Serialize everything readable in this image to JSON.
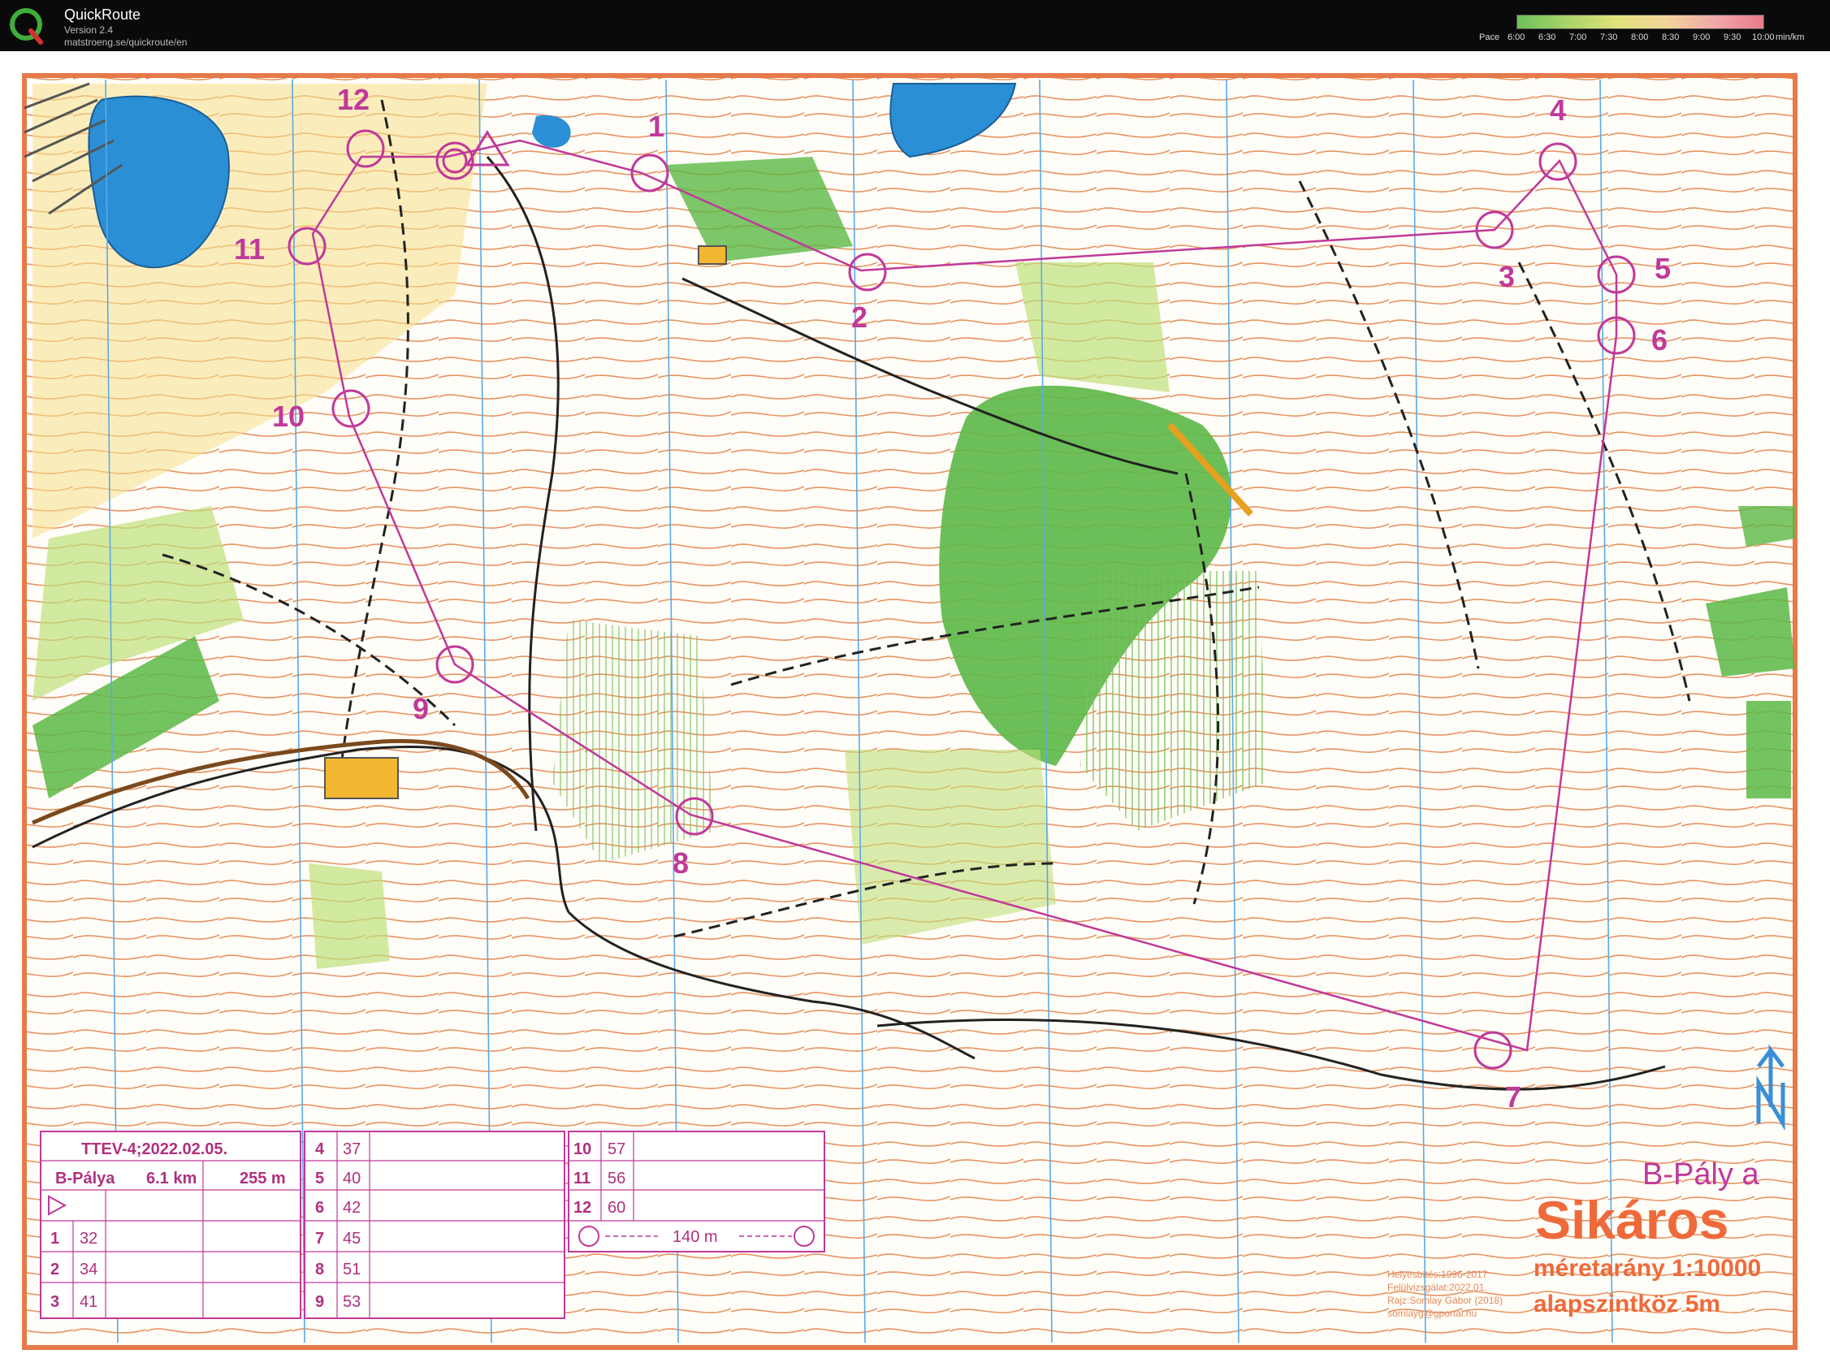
{
  "app": {
    "name": "QuickRoute",
    "version": "Version 2.4",
    "url": "matstroeng.se/quickroute/en"
  },
  "pace_scale": {
    "label": "Pace",
    "ticks": [
      "6:00",
      "6:30",
      "7:00",
      "7:30",
      "8:00",
      "8:30",
      "9:00",
      "9:30",
      "10:00"
    ],
    "unit": "min/km"
  },
  "map": {
    "course_title": "B-Pály a",
    "area_name": "Sikáros",
    "scale_text": "méretarány 1:10000",
    "contour_text": "alapszintköz 5m",
    "credits": [
      "Helyesbítés:1996-2017",
      "Felülvizsgálat:2022.01.",
      "Rajz:Somlay Gábor (2018)",
      "somlayg@gportal.hu"
    ],
    "controls": [
      "1",
      "2",
      "3",
      "4",
      "5",
      "6",
      "7",
      "8",
      "9",
      "10",
      "11",
      "12"
    ]
  },
  "description_table": {
    "event": "TTEV-4;2022.02.05.",
    "course": "B-Pálya",
    "length": "6.1 km",
    "climb": "255 m",
    "rows": [
      {
        "n": "1",
        "code": "32"
      },
      {
        "n": "2",
        "code": "34"
      },
      {
        "n": "3",
        "code": "41"
      },
      {
        "n": "4",
        "code": "37"
      },
      {
        "n": "5",
        "code": "40"
      },
      {
        "n": "6",
        "code": "42"
      },
      {
        "n": "7",
        "code": "45"
      },
      {
        "n": "8",
        "code": "51"
      },
      {
        "n": "9",
        "code": "53"
      },
      {
        "n": "10",
        "code": "57"
      },
      {
        "n": "11",
        "code": "56"
      },
      {
        "n": "12",
        "code": "60"
      }
    ],
    "finish_distance": "140 m"
  },
  "colors": {
    "course": "#c0399a",
    "contour": "#e0793f",
    "forest": "#5cb846",
    "open": "#f7e08a",
    "water": "#2b8fd6"
  }
}
